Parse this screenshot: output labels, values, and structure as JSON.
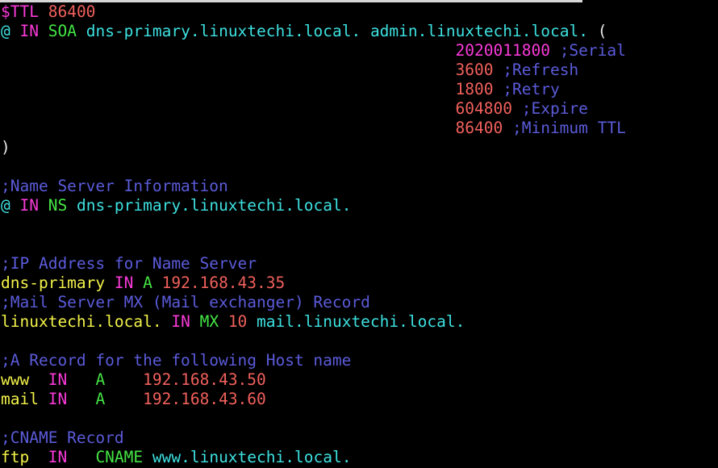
{
  "terminal": {
    "background": "#000000",
    "top_strip_color": "#d6d6d6",
    "palette": {
      "directive": "#f93ad8",
      "number": "#f0605c",
      "serial": "#f93ad8",
      "comment": "#5b5bdb",
      "class": "#f93ad8",
      "type": "#44e544",
      "fqdn": "#3ee0e0",
      "owner": "#f2f24a",
      "paren": "#e8e8e8"
    }
  },
  "file": {
    "description": "BIND DNS forward zone file for linuxtechi.local",
    "lines": [
      {
        "id": "line-ttl",
        "tokens": [
          {
            "text": "$TTL",
            "cls": "t-directive"
          },
          {
            "text": " ",
            "cls": "t-plain"
          },
          {
            "text": "86400",
            "cls": "t-number"
          }
        ]
      },
      {
        "id": "line-soa",
        "tokens": [
          {
            "text": "@",
            "cls": "t-at"
          },
          {
            "text": " ",
            "cls": "t-plain"
          },
          {
            "text": "IN",
            "cls": "t-class"
          },
          {
            "text": " ",
            "cls": "t-plain"
          },
          {
            "text": "SOA",
            "cls": "t-type"
          },
          {
            "text": " ",
            "cls": "t-plain"
          },
          {
            "text": "dns-primary.linuxtechi.local.",
            "cls": "t-fqdn"
          },
          {
            "text": " ",
            "cls": "t-plain"
          },
          {
            "text": "admin.linuxtechi.local.",
            "cls": "t-fqdn"
          },
          {
            "text": " ",
            "cls": "t-plain"
          },
          {
            "text": "(",
            "cls": "t-paren"
          }
        ]
      },
      {
        "id": "line-serial",
        "tokens": [
          {
            "text": "                                                ",
            "cls": "t-plain"
          },
          {
            "text": "2020011800",
            "cls": "t-serial"
          },
          {
            "text": " ",
            "cls": "t-plain"
          },
          {
            "text": ";Serial",
            "cls": "t-comment"
          }
        ]
      },
      {
        "id": "line-refresh",
        "tokens": [
          {
            "text": "                                                ",
            "cls": "t-plain"
          },
          {
            "text": "3600",
            "cls": "t-number"
          },
          {
            "text": " ",
            "cls": "t-plain"
          },
          {
            "text": ";Refresh",
            "cls": "t-comment"
          }
        ]
      },
      {
        "id": "line-retry",
        "tokens": [
          {
            "text": "                                                ",
            "cls": "t-plain"
          },
          {
            "text": "1800",
            "cls": "t-number"
          },
          {
            "text": " ",
            "cls": "t-plain"
          },
          {
            "text": ";Retry",
            "cls": "t-comment"
          }
        ]
      },
      {
        "id": "line-expire",
        "tokens": [
          {
            "text": "                                                ",
            "cls": "t-plain"
          },
          {
            "text": "604800",
            "cls": "t-number"
          },
          {
            "text": " ",
            "cls": "t-plain"
          },
          {
            "text": ";Expire",
            "cls": "t-comment"
          }
        ]
      },
      {
        "id": "line-minimum",
        "tokens": [
          {
            "text": "                                                ",
            "cls": "t-plain"
          },
          {
            "text": "86400",
            "cls": "t-number"
          },
          {
            "text": " ",
            "cls": "t-plain"
          },
          {
            "text": ";Minimum TTL",
            "cls": "t-comment"
          }
        ]
      },
      {
        "id": "line-close-paren",
        "tokens": [
          {
            "text": ")",
            "cls": "t-paren"
          }
        ]
      },
      {
        "id": "line-blank-1",
        "tokens": []
      },
      {
        "id": "line-comment-ns",
        "tokens": [
          {
            "text": ";Name Server Information",
            "cls": "t-comment"
          }
        ]
      },
      {
        "id": "line-ns",
        "tokens": [
          {
            "text": "@",
            "cls": "t-at"
          },
          {
            "text": " ",
            "cls": "t-plain"
          },
          {
            "text": "IN",
            "cls": "t-class"
          },
          {
            "text": " ",
            "cls": "t-plain"
          },
          {
            "text": "NS",
            "cls": "t-type"
          },
          {
            "text": " ",
            "cls": "t-plain"
          },
          {
            "text": "dns-primary.linuxtechi.local.",
            "cls": "t-fqdn"
          }
        ]
      },
      {
        "id": "line-blank-2",
        "tokens": []
      },
      {
        "id": "line-blank-3",
        "tokens": []
      },
      {
        "id": "line-comment-ip",
        "tokens": [
          {
            "text": ";IP Address for Name Server",
            "cls": "t-comment"
          }
        ]
      },
      {
        "id": "line-a-dns-primary",
        "tokens": [
          {
            "text": "dns-primary",
            "cls": "t-owner"
          },
          {
            "text": " ",
            "cls": "t-plain"
          },
          {
            "text": "IN",
            "cls": "t-class"
          },
          {
            "text": " ",
            "cls": "t-plain"
          },
          {
            "text": "A",
            "cls": "t-type"
          },
          {
            "text": " ",
            "cls": "t-plain"
          },
          {
            "text": "192.168.43.35",
            "cls": "t-number"
          }
        ]
      },
      {
        "id": "line-comment-mx",
        "tokens": [
          {
            "text": ";Mail Server MX (Mail exchanger) Record",
            "cls": "t-comment"
          }
        ]
      },
      {
        "id": "line-mx",
        "tokens": [
          {
            "text": "linuxtechi.local.",
            "cls": "t-owner"
          },
          {
            "text": " ",
            "cls": "t-plain"
          },
          {
            "text": "IN",
            "cls": "t-class"
          },
          {
            "text": " ",
            "cls": "t-plain"
          },
          {
            "text": "MX",
            "cls": "t-type"
          },
          {
            "text": " ",
            "cls": "t-plain"
          },
          {
            "text": "10",
            "cls": "t-number"
          },
          {
            "text": " ",
            "cls": "t-plain"
          },
          {
            "text": "mail.linuxtechi.local.",
            "cls": "t-fqdn"
          }
        ]
      },
      {
        "id": "line-blank-4",
        "tokens": []
      },
      {
        "id": "line-comment-a",
        "tokens": [
          {
            "text": ";A Record for the following Host name",
            "cls": "t-comment"
          }
        ]
      },
      {
        "id": "line-a-www",
        "tokens": [
          {
            "text": "www",
            "cls": "t-owner"
          },
          {
            "text": "  ",
            "cls": "t-plain"
          },
          {
            "text": "IN",
            "cls": "t-class"
          },
          {
            "text": "   ",
            "cls": "t-plain"
          },
          {
            "text": "A",
            "cls": "t-type"
          },
          {
            "text": "    ",
            "cls": "t-plain"
          },
          {
            "text": "192.168.43.50",
            "cls": "t-number"
          }
        ]
      },
      {
        "id": "line-a-mail",
        "tokens": [
          {
            "text": "mail",
            "cls": "t-owner"
          },
          {
            "text": " ",
            "cls": "t-plain"
          },
          {
            "text": "IN",
            "cls": "t-class"
          },
          {
            "text": "   ",
            "cls": "t-plain"
          },
          {
            "text": "A",
            "cls": "t-type"
          },
          {
            "text": "    ",
            "cls": "t-plain"
          },
          {
            "text": "192.168.43.60",
            "cls": "t-number"
          }
        ]
      },
      {
        "id": "line-blank-5",
        "tokens": []
      },
      {
        "id": "line-comment-cname",
        "tokens": [
          {
            "text": ";CNAME Record",
            "cls": "t-comment"
          }
        ]
      },
      {
        "id": "line-cname-ftp",
        "tokens": [
          {
            "text": "ftp",
            "cls": "t-owner"
          },
          {
            "text": "  ",
            "cls": "t-plain"
          },
          {
            "text": "IN",
            "cls": "t-class"
          },
          {
            "text": "   ",
            "cls": "t-plain"
          },
          {
            "text": "CNAME",
            "cls": "t-type"
          },
          {
            "text": " ",
            "cls": "t-plain"
          },
          {
            "text": "www.linuxtechi.local.",
            "cls": "t-fqdn"
          }
        ]
      }
    ]
  }
}
